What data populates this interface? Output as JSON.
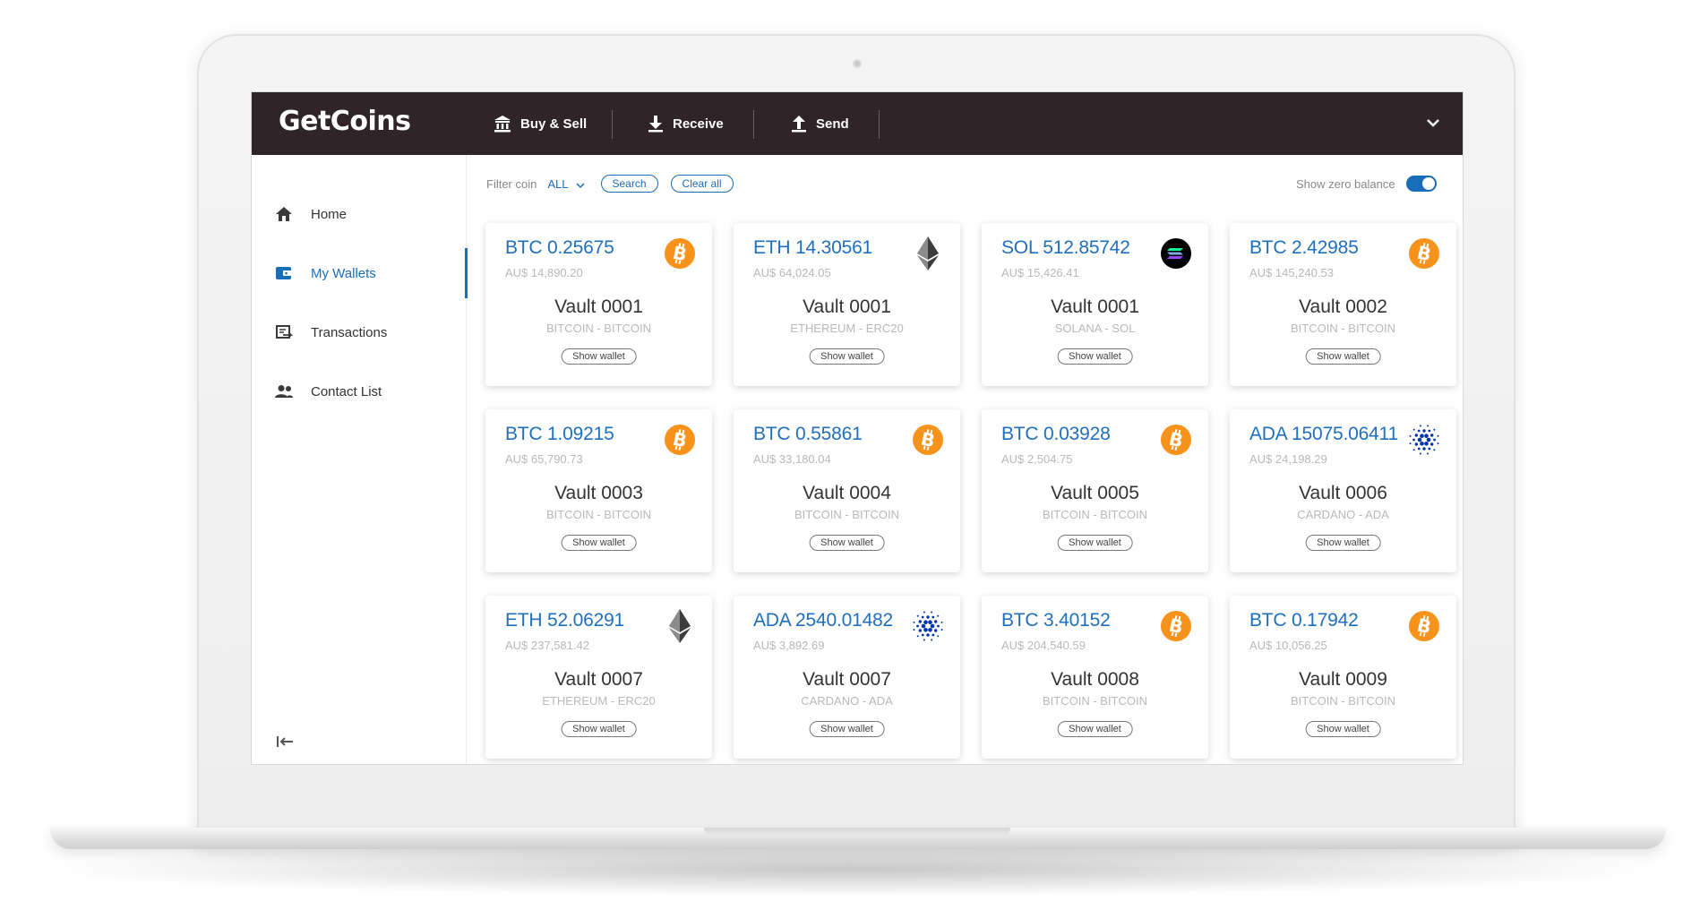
{
  "app": {
    "logo": "GetCoins"
  },
  "topnav": {
    "items": [
      {
        "label": "Buy & Sell",
        "icon": "bank-icon"
      },
      {
        "label": "Receive",
        "icon": "download-icon"
      },
      {
        "label": "Send",
        "icon": "upload-icon"
      }
    ],
    "account_menu_icon": "chevron-down-icon"
  },
  "sidebar": {
    "items": [
      {
        "label": "Home",
        "icon": "home-icon",
        "active": false
      },
      {
        "label": "My Wallets",
        "icon": "wallet-icon",
        "active": true
      },
      {
        "label": "Transactions",
        "icon": "transactions-icon",
        "active": false
      },
      {
        "label": "Contact List",
        "icon": "contacts-icon",
        "active": false
      }
    ],
    "collapse_icon": "collapse-left-icon"
  },
  "filter": {
    "label": "Filter coin",
    "selected": "ALL",
    "search_label": "Search",
    "clear_label": "Clear all",
    "zero_balance_label": "Show zero balance",
    "zero_balance_on": true
  },
  "colors": {
    "topbar": "#2f2529",
    "accent": "#1a6db8",
    "bitcoin": "#f7931a",
    "ethereum": "#3c3c3d",
    "cardano": "#0033ad",
    "solana": "#000000"
  },
  "wallets": [
    {
      "amount": "BTC  0.25675",
      "fiat": "AU$ 14,890.20",
      "name": "Vault 0001",
      "chain": "BITCOIN - BITCOIN",
      "coin": "bitcoin",
      "button": "Show wallet"
    },
    {
      "amount": "ETH  14.30561",
      "fiat": "AU$ 64,024.05",
      "name": "Vault 0001",
      "chain": "ETHEREUM - ERC20",
      "coin": "ethereum",
      "button": "Show wallet"
    },
    {
      "amount": "SOL 512.85742",
      "fiat": "AU$ 15,426.41",
      "name": "Vault 0001",
      "chain": "SOLANA - SOL",
      "coin": "solana",
      "button": "Show wallet"
    },
    {
      "amount": "BTC  2.42985",
      "fiat": "AU$ 145,240.53",
      "name": "Vault 0002",
      "chain": "BITCOIN - BITCOIN",
      "coin": "bitcoin",
      "button": "Show wallet"
    },
    {
      "amount": "BTC  1.09215",
      "fiat": "AU$ 65,790.73",
      "name": "Vault 0003",
      "chain": "BITCOIN - BITCOIN",
      "coin": "bitcoin",
      "button": "Show wallet"
    },
    {
      "amount": "BTC  0.55861",
      "fiat": "AU$ 33,180.04",
      "name": "Vault 0004",
      "chain": "BITCOIN - BITCOIN",
      "coin": "bitcoin",
      "button": "Show wallet"
    },
    {
      "amount": "BTC  0.03928",
      "fiat": "AU$ 2,504.75",
      "name": "Vault 0005",
      "chain": "BITCOIN - BITCOIN",
      "coin": "bitcoin",
      "button": "Show wallet"
    },
    {
      "amount": "ADA 15075.06411",
      "fiat": "AU$ 24,198.29",
      "name": "Vault 0006",
      "chain": "CARDANO - ADA",
      "coin": "cardano",
      "button": "Show wallet"
    },
    {
      "amount": "ETH  52.06291",
      "fiat": "AU$ 237,581.42",
      "name": "Vault 0007",
      "chain": "ETHEREUM - ERC20",
      "coin": "ethereum",
      "button": "Show wallet"
    },
    {
      "amount": "ADA 2540.01482",
      "fiat": "AU$ 3,892.69",
      "name": "Vault 0007",
      "chain": "CARDANO - ADA",
      "coin": "cardano",
      "button": "Show wallet"
    },
    {
      "amount": "BTC  3.40152",
      "fiat": "AU$ 204,540.59",
      "name": "Vault 0008",
      "chain": "BITCOIN - BITCOIN",
      "coin": "bitcoin",
      "button": "Show wallet"
    },
    {
      "amount": "BTC  0.17942",
      "fiat": "AU$ 10,056.25",
      "name": "Vault 0009",
      "chain": "BITCOIN - BITCOIN",
      "coin": "bitcoin",
      "button": "Show wallet"
    }
  ]
}
